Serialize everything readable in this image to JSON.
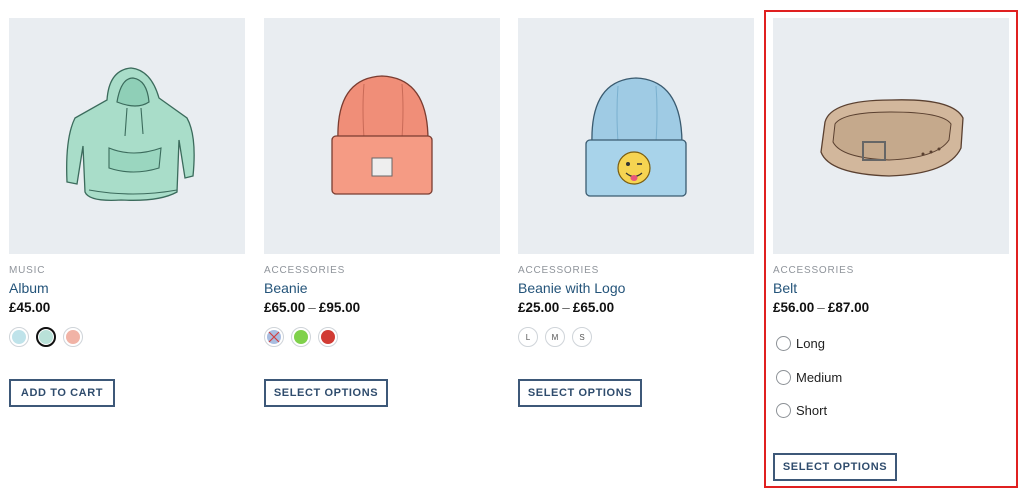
{
  "products": [
    {
      "category": "MUSIC",
      "title": "Album",
      "price": "£45.00",
      "button": "ADD TO CART",
      "image_icon": "hoodie-icon",
      "swatches": [
        {
          "color": "#bfe3ea",
          "icon": "tshirt-blue-icon"
        },
        {
          "color": "#b9e1d8",
          "icon": "tshirt-teal-icon"
        },
        {
          "color": "#f1b3a6",
          "icon": "tshirt-pink-icon"
        }
      ]
    },
    {
      "category": "ACCESSORIES",
      "title": "Beanie",
      "price_min": "£65.00",
      "price_sep": "–",
      "price_max": "£95.00",
      "button": "SELECT OPTIONS",
      "image_icon": "beanie-coral-icon",
      "swatches": [
        {
          "color": "#a9bde0",
          "icon": "unavailable-swatch-icon"
        },
        {
          "color": "#7fd14b",
          "icon": "green-swatch-icon"
        },
        {
          "color": "#d13b34",
          "icon": "red-swatch-icon"
        }
      ]
    },
    {
      "category": "ACCESSORIES",
      "title": "Beanie with Logo",
      "price_min": "£25.00",
      "price_sep": "–",
      "price_max": "£65.00",
      "button": "SELECT OPTIONS",
      "image_icon": "beanie-logo-icon",
      "sizes": [
        "L",
        "M",
        "S"
      ]
    },
    {
      "category": "ACCESSORIES",
      "title": "Belt",
      "price_min": "£56.00",
      "price_sep": "–",
      "price_max": "£87.00",
      "button": "SELECT OPTIONS",
      "image_icon": "belt-icon",
      "options": [
        "Long",
        "Medium",
        "Short"
      ]
    }
  ],
  "colors": {
    "image_bg": "#e9edf1",
    "title": "#24547a",
    "button_border": "#3d5878",
    "highlight": "#e02020"
  }
}
